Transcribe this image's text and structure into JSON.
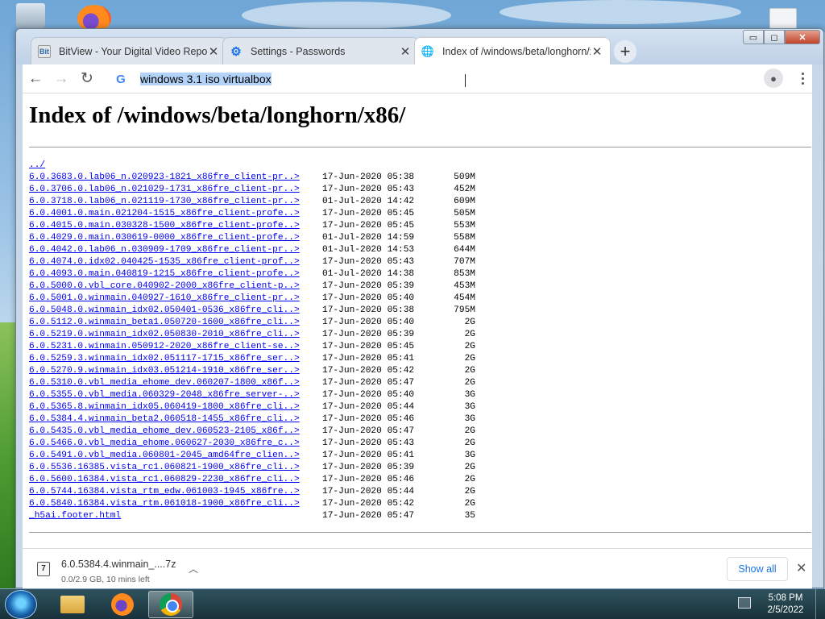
{
  "browser": {
    "tabs": [
      {
        "label": "BitView - Your Digital Video Repository",
        "favicon": "Bit"
      },
      {
        "label": "Settings - Passwords",
        "favicon": "gear-icon"
      },
      {
        "label": "Index of /windows/beta/longhorn/x86/",
        "favicon": "page-icon"
      }
    ],
    "active_tab": 2,
    "window_controls": {
      "minimize": "▭",
      "maximize": "◻",
      "close": "✕"
    },
    "omnibox": {
      "engine_icon": "G",
      "text_highlight": "windows 3.1 iso virtualbox"
    }
  },
  "page": {
    "title": "Index of /windows/beta/longhorn/x86/",
    "parent": "../",
    "entries": [
      {
        "name": "6.0.3683.0.lab06_n.020923-1821_x86fre_client-pr..>",
        "date": "17-Jun-2020 05:38",
        "size": "509M"
      },
      {
        "name": "6.0.3706.0.lab06_n.021029-1731_x86fre_client-pr..>",
        "date": "17-Jun-2020 05:43",
        "size": "452M"
      },
      {
        "name": "6.0.3718.0.lab06_n.021119-1730_x86fre_client-pr..>",
        "date": "01-Jul-2020 14:42",
        "size": "609M"
      },
      {
        "name": "6.0.4001.0.main.021204-1515_x86fre_client-profe..>",
        "date": "17-Jun-2020 05:45",
        "size": "505M"
      },
      {
        "name": "6.0.4015.0.main.030328-1500_x86fre_client-profe..>",
        "date": "17-Jun-2020 05:45",
        "size": "553M"
      },
      {
        "name": "6.0.4029.0.main.030619-0000_x86fre_client-profe..>",
        "date": "01-Jul-2020 14:59",
        "size": "558M"
      },
      {
        "name": "6.0.4042.0.lab06_n.030909-1709_x86fre_client-pr..>",
        "date": "01-Jul-2020 14:53",
        "size": "644M"
      },
      {
        "name": "6.0.4074.0.idx02.040425-1535_x86fre_client-prof..>",
        "date": "17-Jun-2020 05:43",
        "size": "707M"
      },
      {
        "name": "6.0.4093.0.main.040819-1215_x86fre_client-profe..>",
        "date": "01-Jul-2020 14:38",
        "size": "853M"
      },
      {
        "name": "6.0.5000.0.vbl_core.040902-2000_x86fre_client-p..>",
        "date": "17-Jun-2020 05:39",
        "size": "453M"
      },
      {
        "name": "6.0.5001.0.winmain.040927-1610_x86fre_client-pr..>",
        "date": "17-Jun-2020 05:40",
        "size": "454M"
      },
      {
        "name": "6.0.5048.0.winmain_idx02.050401-0536_x86fre_cli..>",
        "date": "17-Jun-2020 05:38",
        "size": "795M"
      },
      {
        "name": "6.0.5112.0.winmain_beta1.050720-1600_x86fre_cli..>",
        "date": "17-Jun-2020 05:40",
        "size": "2G"
      },
      {
        "name": "6.0.5219.0.winmain_idx02.050830-2010_x86fre_cli..>",
        "date": "17-Jun-2020 05:39",
        "size": "2G"
      },
      {
        "name": "6.0.5231.0.winmain.050912-2020_x86fre_client-se..>",
        "date": "17-Jun-2020 05:45",
        "size": "2G"
      },
      {
        "name": "6.0.5259.3.winmain_idx02.051117-1715_x86fre_ser..>",
        "date": "17-Jun-2020 05:41",
        "size": "2G"
      },
      {
        "name": "6.0.5270.9.winmain_idx03.051214-1910_x86fre_ser..>",
        "date": "17-Jun-2020 05:42",
        "size": "2G"
      },
      {
        "name": "6.0.5310.0.vbl_media_ehome_dev.060207-1800_x86f..>",
        "date": "17-Jun-2020 05:47",
        "size": "2G"
      },
      {
        "name": "6.0.5355.0.vbl_media.060329-2048_x86fre_server-..>",
        "date": "17-Jun-2020 05:40",
        "size": "3G"
      },
      {
        "name": "6.0.5365.8.winmain_idx05.060419-1800_x86fre_cli..>",
        "date": "17-Jun-2020 05:44",
        "size": "3G"
      },
      {
        "name": "6.0.5384.4.winmain_beta2.060518-1455_x86fre_cli..>",
        "date": "17-Jun-2020 05:46",
        "size": "3G"
      },
      {
        "name": "6.0.5435.0.vbl_media_ehome_dev.060523-2105_x86f..>",
        "date": "17-Jun-2020 05:47",
        "size": "2G"
      },
      {
        "name": "6.0.5466.0.vbl_media_ehome.060627-2030_x86fre_c..>",
        "date": "17-Jun-2020 05:43",
        "size": "2G"
      },
      {
        "name": "6.0.5491.0.vbl_media.060801-2045_amd64fre_clien..>",
        "date": "17-Jun-2020 05:41",
        "size": "3G"
      },
      {
        "name": "6.0.5536.16385.vista_rc1.060821-1900_x86fre_cli..>",
        "date": "17-Jun-2020 05:39",
        "size": "2G"
      },
      {
        "name": "6.0.5600.16384.vista_rc1.060829-2230_x86fre_cli..>",
        "date": "17-Jun-2020 05:46",
        "size": "2G"
      },
      {
        "name": "6.0.5744.16384.vista_rtm_edw.061003-1945_x86fre..>",
        "date": "17-Jun-2020 05:44",
        "size": "2G"
      },
      {
        "name": "6.0.5840.16384.vista_rtm.061018-1900_x86fre_cli..>",
        "date": "17-Jun-2020 05:42",
        "size": "2G"
      },
      {
        "name": "_h5ai.footer.html",
        "date": "17-Jun-2020 05:47",
        "size": "35"
      }
    ]
  },
  "downloads": {
    "item_name": "6.0.5384.4.winmain_....7z",
    "item_status": "0.0/2.9 GB, 10 mins left",
    "show_all": "Show all"
  },
  "taskbar": {
    "time": "5:08 PM",
    "date": "2/5/2022"
  }
}
